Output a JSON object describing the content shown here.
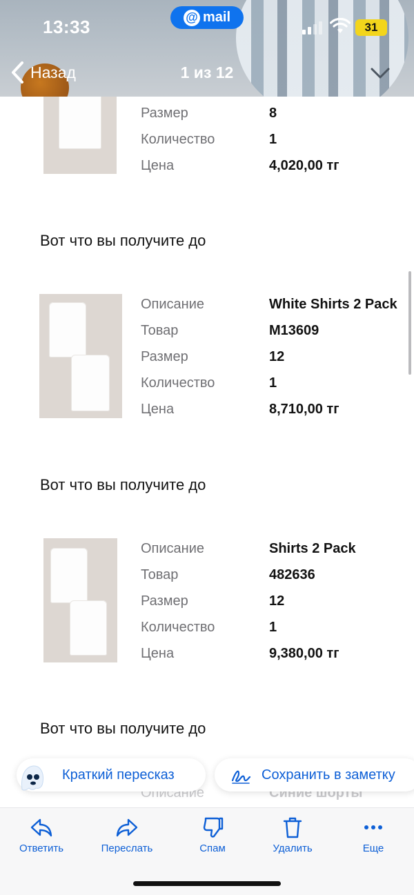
{
  "status_bar": {
    "time": "13:33",
    "pill_label": "mail",
    "battery": "31"
  },
  "nav": {
    "back_label": "Назад",
    "counter": "1 из 12"
  },
  "products": [
    {
      "rows": [
        {
          "label": "Размер",
          "value": "8"
        },
        {
          "label": "Количество",
          "value": "1"
        },
        {
          "label": "Цена",
          "value": "4,020,00 тг"
        }
      ]
    },
    {
      "rows": [
        {
          "label": "Описание",
          "value": "White Shirts 2 Pack"
        },
        {
          "label": "Товар",
          "value": "M13609"
        },
        {
          "label": "Размер",
          "value": "12"
        },
        {
          "label": "Количество",
          "value": "1"
        },
        {
          "label": "Цена",
          "value": "8,710,00 тг"
        }
      ]
    },
    {
      "rows": [
        {
          "label": "Описание",
          "value": "Shirts 2 Pack"
        },
        {
          "label": "Товар",
          "value": "482636"
        },
        {
          "label": "Размер",
          "value": "12"
        },
        {
          "label": "Количество",
          "value": "1"
        },
        {
          "label": "Цена",
          "value": "9,380,00 тг"
        }
      ]
    }
  ],
  "sections": [
    {
      "title": "Вот что вы получите до"
    },
    {
      "title": "Вот что вы получите до"
    },
    {
      "title": "Вот что вы получите до"
    }
  ],
  "partial_row": {
    "label": "Описание",
    "value": "Синие шорты"
  },
  "chips": {
    "summary": "Краткий пересказ",
    "save_note": "Сохранить в заметку"
  },
  "toolbar": {
    "reply": "Ответить",
    "forward": "Переслать",
    "spam": "Спам",
    "delete": "Удалить",
    "more": "Еще"
  },
  "colors": {
    "accent": "#0d5fd6",
    "mail_pill": "#0f73ee",
    "battery": "#f3d51b"
  }
}
